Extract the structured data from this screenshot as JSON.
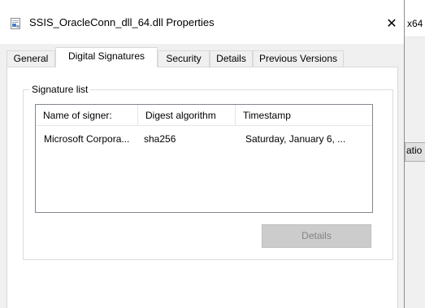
{
  "window": {
    "title": "SSIS_OracleConn_dll_64.dll Properties",
    "close_glyph": "✕"
  },
  "background_window": {
    "title_fragment": "x64",
    "button_fragment": "atio"
  },
  "tabs": [
    {
      "label": "General",
      "active": false
    },
    {
      "label": "Digital Signatures",
      "active": true
    },
    {
      "label": "Security",
      "active": false
    },
    {
      "label": "Details",
      "active": false
    },
    {
      "label": "Previous Versions",
      "active": false
    }
  ],
  "signature_list": {
    "group_label": "Signature list",
    "columns": [
      "Name of signer:",
      "Digest algorithm",
      "Timestamp"
    ],
    "rows": [
      [
        "Microsoft Corpora...",
        "sha256",
        "Saturday, January 6, ..."
      ]
    ]
  },
  "details_button": {
    "label": "Details",
    "enabled": false
  },
  "icons": {
    "title_icon": "dll-file-icon",
    "close": "close-icon"
  },
  "colors": {
    "dialog_background": "#f0f0f0",
    "panel_background": "#ffffff",
    "disabled_button": "#cccccc",
    "disabled_text": "#838383"
  }
}
